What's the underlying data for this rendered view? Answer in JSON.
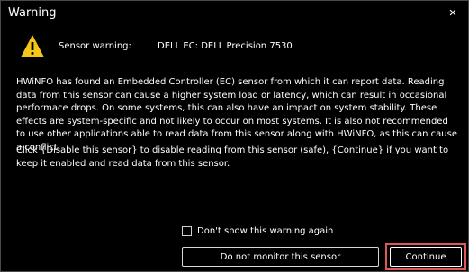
{
  "window": {
    "title": "Warning",
    "close_glyph": "✕"
  },
  "header": {
    "icon": "warning-triangle-icon",
    "label": "Sensor warning:",
    "value": "DELL EC: DELL Precision 7530"
  },
  "body": {
    "paragraph1": "HWiNFO has found an Embedded Controller (EC) sensor from which it can report data. Reading data from this sensor can cause a higher system load or latency, which can result in occasional performace drops. On some systems, this can also have an impact on system stability. These effects are system-specific and not likely to occur on most systems. It is also not recommended to use other applications able to read data from this sensor along with HWiNFO, as this can cause a conflict.",
    "paragraph2": "Click {Disable this sensor} to disable reading from this sensor (safe), {Continue} if you want to keep it enabled and read data from this sensor."
  },
  "controls": {
    "dont_show_label": "Don't show this warning again",
    "dont_show_checked": false,
    "do_not_monitor_label": "Do not monitor this sensor",
    "continue_label": "Continue"
  },
  "colors": {
    "background": "#000000",
    "warning_yellow": "#f5c518",
    "highlight_red": "#e0565b"
  }
}
